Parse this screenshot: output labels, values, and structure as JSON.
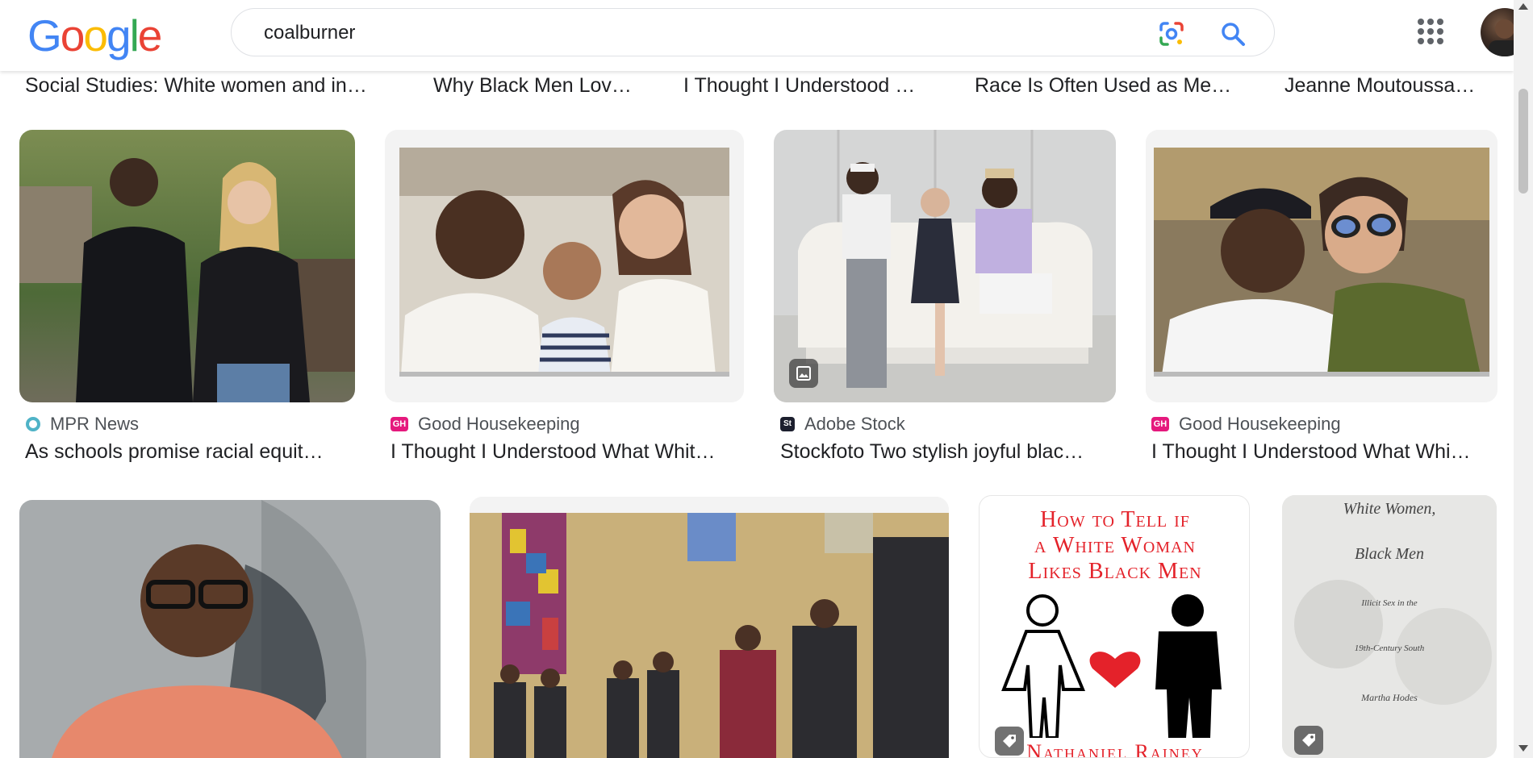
{
  "header": {
    "logo_letters": [
      "G",
      "o",
      "o",
      "g",
      "l",
      "e"
    ],
    "logo_colors": [
      "#4285F4",
      "#EA4335",
      "#FBBC05",
      "#4285F4",
      "#34A853",
      "#EA4335"
    ],
    "search_value": "coalburner",
    "icons": {
      "lens": "google-lens-icon",
      "search": "search-icon",
      "apps": "apps-grid-icon",
      "avatar": "account-avatar"
    }
  },
  "top_captions": [
    "Social Studies: White women and in…",
    "Why Black Men Lov…",
    "I Thought I Understood …",
    "Race Is Often Used as Me…",
    "Jeanne Moutoussa…"
  ],
  "row1": [
    {
      "source": "MPR News",
      "title": "As schools promise racial equit…",
      "fav_color": "#4fb3c7"
    },
    {
      "source": "Good Housekeeping",
      "title": "I Thought I Understood What Whit…",
      "fav_color": "#e5197d",
      "fav_text": "GH"
    },
    {
      "source": "Adobe Stock",
      "title": "Stockfoto Two stylish joyful blac…",
      "fav_color": "#1c1f2e",
      "fav_text": "St"
    },
    {
      "source": "Good Housekeeping",
      "title": "I Thought I Understood What Whi…",
      "fav_color": "#e5197d",
      "fav_text": "GH"
    }
  ],
  "book": {
    "line1": "How to Tell if",
    "line2": "a White Woman",
    "line3": "Likes Black Men",
    "author": "Nathaniel Rainey",
    "color": "#e4222a"
  },
  "book2": {
    "line1": "White Women,",
    "line2": "Black Men",
    "line3": "Illicit Sex in the",
    "line4": "19th-Century South",
    "line5": "Martha Hodes"
  }
}
